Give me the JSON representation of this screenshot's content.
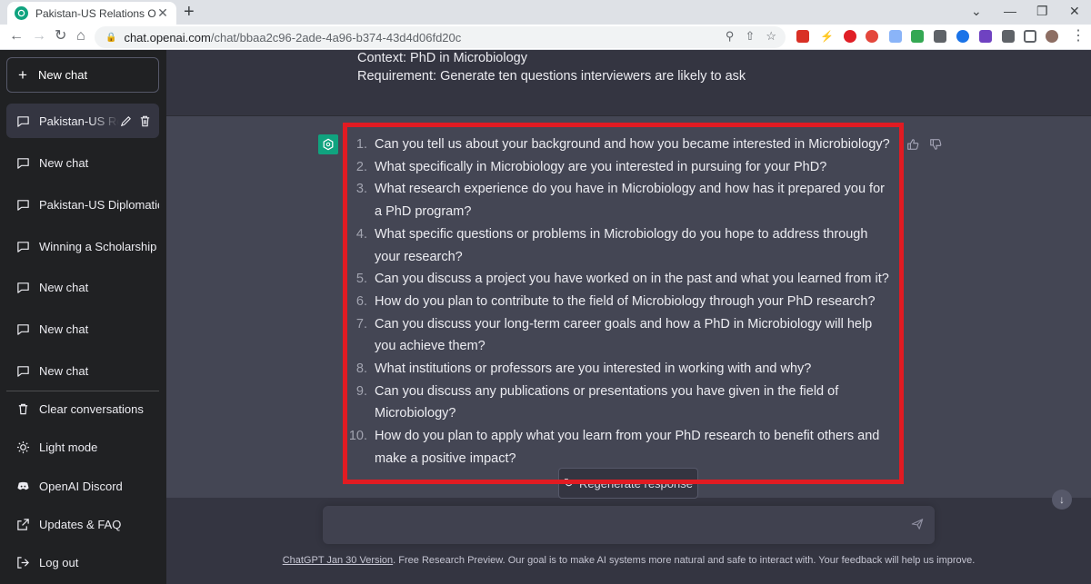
{
  "browser": {
    "tab_title": "Pakistan-US Relations Outline",
    "tab_close": "✕",
    "new_tab": "+",
    "url_host": "chat.openai.com",
    "url_path": "/chat/bbaa2c96-2ade-4a96-b374-43d4d06fd20c",
    "window_controls": [
      "⌄",
      "—",
      "❐",
      "✕"
    ]
  },
  "sidebar": {
    "new_chat_label": "New chat",
    "history": [
      {
        "label": "Pakistan-US Relations Outline",
        "active": true
      },
      {
        "label": "New chat"
      },
      {
        "label": "Pakistan-US Diplomatic"
      },
      {
        "label": "Winning a Scholarship"
      },
      {
        "label": "New chat"
      },
      {
        "label": "New chat"
      },
      {
        "label": "New chat"
      }
    ],
    "bottom": [
      {
        "label": "Clear conversations",
        "icon": "trash-icon"
      },
      {
        "label": "Light mode",
        "icon": "sun-icon"
      },
      {
        "label": "OpenAI Discord",
        "icon": "discord-icon"
      },
      {
        "label": "Updates & FAQ",
        "icon": "external-link-icon"
      },
      {
        "label": "Log out",
        "icon": "logout-icon"
      }
    ]
  },
  "conversation": {
    "user_lines": [
      "Context: PhD in Microbiology",
      "Requirement: Generate ten questions interviewers are likely to ask"
    ],
    "answer": [
      {
        "num": "1.",
        "text": "Can you tell us about your background and how you became interested in Microbiology?"
      },
      {
        "num": "2.",
        "text": "What specifically in Microbiology are you interested in pursuing for your PhD?"
      },
      {
        "num": "3.",
        "text": "What research experience do you have in Microbiology and how has it prepared you for a PhD program?"
      },
      {
        "num": "4.",
        "text": "What specific questions or problems in Microbiology do you hope to address through your research?"
      },
      {
        "num": "5.",
        "text": "Can you discuss a project you have worked on in the past and what you learned from it?"
      },
      {
        "num": "6.",
        "text": "How do you plan to contribute to the field of Microbiology through your PhD research?"
      },
      {
        "num": "7.",
        "text": "Can you discuss your long-term career goals and how a PhD in Microbiology will help you achieve them?"
      },
      {
        "num": "8.",
        "text": "What institutions or professors are you interested in working with and why?"
      },
      {
        "num": "9.",
        "text": "Can you discuss any publications or presentations you have given in the field of Microbiology?"
      },
      {
        "num": "10.",
        "text": "How do you plan to apply what you learn from your PhD research to benefit others and make a positive impact?"
      }
    ],
    "regenerate_label": "Regenerate response",
    "input_placeholder": ""
  },
  "footer": {
    "version_link": "ChatGPT Jan 30 Version",
    "text": ". Free Research Preview. Our goal is to make AI systems more natural and safe to interact with. Your feedback will help us improve."
  },
  "colors": {
    "sidebar_bg": "#202123",
    "main_bg": "#343541",
    "assistant_bg": "#444654",
    "brand_green": "#10a37f",
    "highlight_red": "#e11b22"
  }
}
